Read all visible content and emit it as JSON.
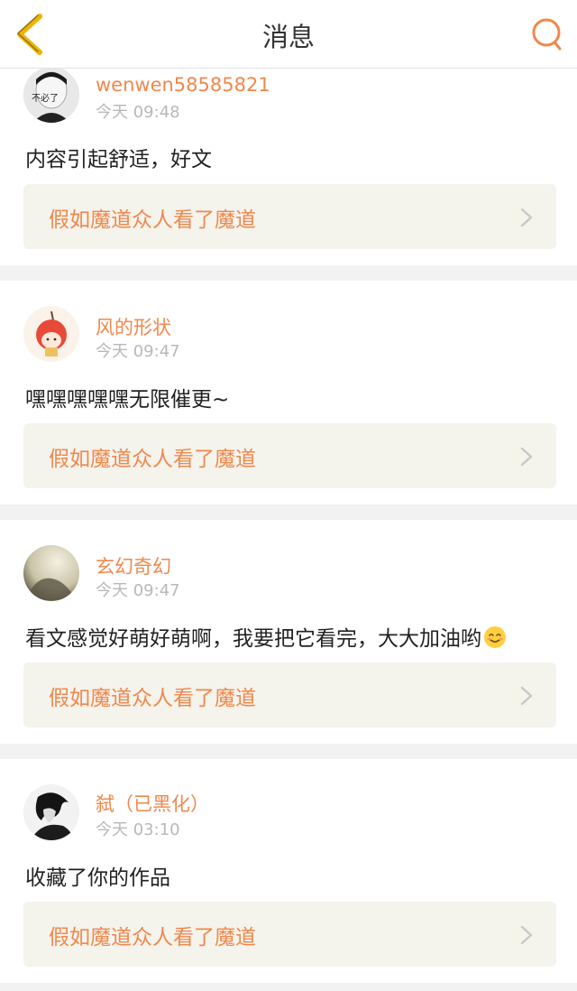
{
  "header": {
    "title": "消息",
    "back_icon": "back-chevron-icon",
    "search_icon": "search-icon",
    "accent": "#f0b400",
    "search_color": "#f0884c"
  },
  "colors": {
    "username": "#f0884c",
    "timestamp": "#b8b8b8",
    "work_bg": "#f4f3ec"
  },
  "messages": [
    {
      "username": "wenwen58585821",
      "time": "今天 09:48",
      "text": "内容引起舒适，好文",
      "work_title": "假如魔道众人看了魔道",
      "avatar_text": "不必了"
    },
    {
      "username": "风的形状",
      "time": "今天 09:47",
      "text": "嘿嘿嘿嘿嘿无限催更~",
      "work_title": "假如魔道众人看了魔道"
    },
    {
      "username": "玄幻奇幻",
      "time": "今天 09:47",
      "text": "看文感觉好萌好萌啊，我要把它看完，大大加油哟",
      "emoji": "😊",
      "work_title": "假如魔道众人看了魔道"
    },
    {
      "username": "弑（已黑化）",
      "time": "今天 03:10",
      "text": "收藏了你的作品",
      "work_title": "假如魔道众人看了魔道"
    }
  ]
}
